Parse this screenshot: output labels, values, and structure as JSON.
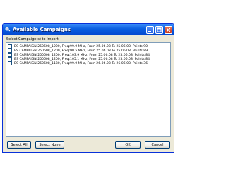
{
  "window": {
    "title": "Available Campaigns",
    "title_color": "#ffffff",
    "titlebar_color": "#0a5ee0",
    "icon": "app-tools-icon",
    "controls": [
      "minimize-icon",
      "maximize-icon",
      "close-icon"
    ]
  },
  "list": {
    "label": "Select Campaign(s) to Import",
    "items": [
      {
        "label": "BS CAMPAIGN 250608_1200, Freq:99.9 MHz, From 25.06.08 To 25.06.08, Points:90",
        "checked": false
      },
      {
        "label": "BS CAMPAIGN 250608_1200, Freq:90.5 MHz, From 25.06.08 To 25.06.08, Points:89",
        "checked": false
      },
      {
        "label": "BS CAMPAIGN 250608_1200, Freq:103.9 MHz, From 25.06.08 To 25.06.08, Points:84",
        "checked": false
      },
      {
        "label": "BS CAMPAIGN 250608_1200, Freq:105.1 MHz, From 25.06.08 To 25.06.08, Points:84",
        "checked": false
      },
      {
        "label": "BS CAMPAIGN 260608_1130, Freq:99.9 MHz, From 26.06.08 To 26.06.08, Points:36",
        "checked": false
      }
    ]
  },
  "buttons": {
    "select_all": "Select All",
    "select_none": "Select None",
    "ok": "OK",
    "cancel": "Cancel"
  }
}
